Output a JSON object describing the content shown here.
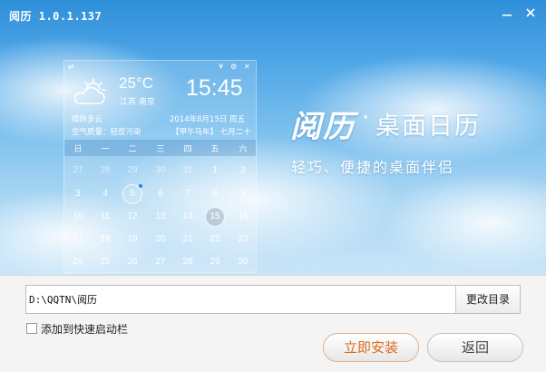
{
  "window": {
    "title": "阅历  1.0.1.137",
    "minimize_icon": "minimize-icon",
    "close_icon": "close-icon"
  },
  "widget": {
    "top_icons": [
      "swap-icon",
      "pin-icon",
      "settings-icon",
      "close-icon"
    ],
    "weather_icon": "partly-cloudy-icon",
    "temperature": "25°C",
    "location": "江苏  南京",
    "time": "15:45",
    "weather_desc": "晴转多云",
    "date": "2014年8月15日 周五",
    "air_quality": "空气质量：轻度污染",
    "lunar": "【甲午马年】 七月二十",
    "weekdays": [
      "日",
      "一",
      "二",
      "三",
      "四",
      "五",
      "六"
    ],
    "weeks": [
      [
        "27",
        "28",
        "29",
        "30",
        "31",
        "1",
        "2"
      ],
      [
        "3",
        "4",
        "5",
        "6",
        "7",
        "8",
        "9"
      ],
      [
        "10",
        "11",
        "12",
        "13",
        "14",
        "15",
        "16"
      ],
      [
        "17",
        "18",
        "19",
        "20",
        "21",
        "22",
        "23"
      ],
      [
        "24",
        "25",
        "26",
        "27",
        "28",
        "29",
        "30"
      ]
    ],
    "prev_month_days_in_first_week": 5,
    "marked_day": "5",
    "today": "15"
  },
  "brand": {
    "logo_text": "阅历",
    "separator": "·",
    "name": "桌面日历",
    "slogan": "轻巧、便捷的桌面伴侣"
  },
  "install": {
    "path_value": "D:\\QQTN\\阅历",
    "browse_label": "更改目录",
    "quicklaunch_label": "添加到快速启动栏",
    "quicklaunch_checked": false,
    "install_label": "立即安装",
    "back_label": "返回"
  },
  "colors": {
    "sky_top": "#2f8fda",
    "sky_bottom": "#c8e5f8",
    "install_text": "#e06a17",
    "marker_dot": "#2f7fd8"
  }
}
